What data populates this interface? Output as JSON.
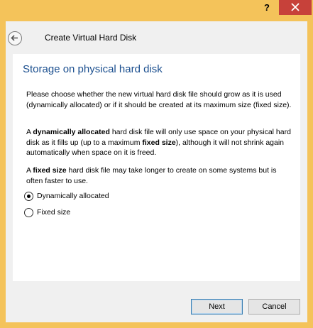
{
  "titlebar": {
    "help_label": "?",
    "close_label": "Close"
  },
  "dialog": {
    "title": "Create Virtual Hard Disk"
  },
  "section": {
    "heading": "Storage on physical hard disk"
  },
  "paragraphs": {
    "p1": "Please choose whether the new virtual hard disk file should grow as it is used (dynamically allocated) or if it should be created at its maximum size (fixed size).",
    "p2_pre": "A ",
    "p2_bold1": "dynamically allocated",
    "p2_mid": " hard disk file will only use space on your physical hard disk as it fills up (up to a maximum ",
    "p2_bold2": "fixed size",
    "p2_post": "), although it will not shrink again automatically when space on it is freed.",
    "p3_pre": "A ",
    "p3_bold": "fixed size",
    "p3_post": " hard disk file may take longer to create on some systems but is often faster to use."
  },
  "options": [
    {
      "label": "Dynamically allocated",
      "selected": true
    },
    {
      "label": "Fixed size",
      "selected": false
    }
  ],
  "buttons": {
    "next": "Next",
    "cancel": "Cancel"
  },
  "colors": {
    "frame": "#f4c35a",
    "close": "#c7413a",
    "heading": "#1b4f8f"
  }
}
